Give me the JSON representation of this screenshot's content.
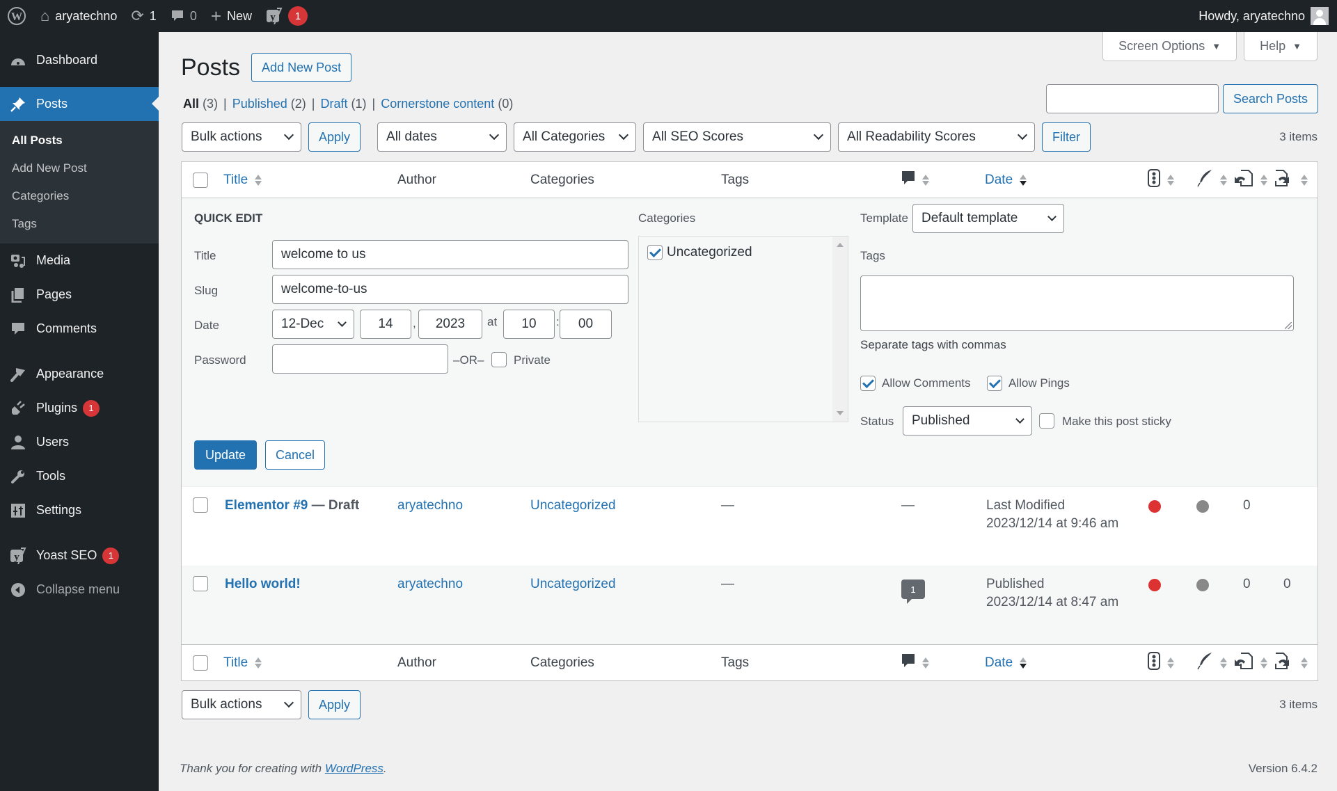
{
  "adminbar": {
    "wp_logo": "wordpress-logo",
    "site_name": "aryatechno",
    "updates_count": "1",
    "comments_count": "0",
    "new_label": "New",
    "yoast_badge": "1",
    "howdy": "Howdy, aryatechno"
  },
  "sidebar": {
    "dashboard": "Dashboard",
    "posts": "Posts",
    "posts_sub": [
      "All Posts",
      "Add New Post",
      "Categories",
      "Tags"
    ],
    "media": "Media",
    "pages": "Pages",
    "comments": "Comments",
    "appearance": "Appearance",
    "plugins": "Plugins",
    "plugins_badge": "1",
    "users": "Users",
    "tools": "Tools",
    "settings": "Settings",
    "yoast": "Yoast SEO",
    "yoast_badge": "1",
    "collapse": "Collapse menu"
  },
  "screen_meta": {
    "screen_options": "Screen Options",
    "help": "Help"
  },
  "page": {
    "title": "Posts",
    "add_new": "Add New Post"
  },
  "views": [
    {
      "label": "All",
      "count": "(3)"
    },
    {
      "label": "Published",
      "count": "(2)"
    },
    {
      "label": "Draft",
      "count": "(1)"
    },
    {
      "label": "Cornerstone content",
      "count": "(0)"
    }
  ],
  "search": {
    "value": "",
    "button": "Search Posts"
  },
  "tablenav_top": {
    "bulk": "Bulk actions",
    "apply": "Apply",
    "dates": "All dates",
    "categories": "All Categories",
    "seo": "All SEO Scores",
    "readability": "All Readability Scores",
    "filter": "Filter",
    "items": "3 items"
  },
  "columns": {
    "title": "Title",
    "author": "Author",
    "categories": "Categories",
    "tags": "Tags",
    "date": "Date"
  },
  "quick_edit": {
    "heading": "QUICK EDIT",
    "title_label": "Title",
    "title_value": "welcome to us",
    "slug_label": "Slug",
    "slug_value": "welcome-to-us",
    "date_label": "Date",
    "month": "12-Dec",
    "day": "14",
    "year": "2023",
    "at": "at",
    "hour": "10",
    "minute": "00",
    "password_label": "Password",
    "password_value": "",
    "or": "–OR–",
    "private_label": "Private",
    "private_checked": false,
    "categories_label": "Categories",
    "category_items": [
      {
        "label": "Uncategorized",
        "checked": true
      }
    ],
    "template_label": "Template",
    "template_value": "Default template",
    "tags_label": "Tags",
    "tags_value": "",
    "tags_hint": "Separate tags with commas",
    "allow_comments": "Allow Comments",
    "allow_pings": "Allow Pings",
    "status_label": "Status",
    "status_value": "Published",
    "sticky_label": "Make this post sticky",
    "update": "Update",
    "cancel": "Cancel"
  },
  "rows": [
    {
      "title": "Elementor #9",
      "state": " — Draft",
      "author": "aryatechno",
      "category": "Uncategorized",
      "tags": "—",
      "comments": "—",
      "date_status": "Last Modified",
      "date": "2023/12/14 at 9:46 am",
      "seo_color": "#dc3232",
      "readability_color": "#888888",
      "links_out": "0",
      "links_in": ""
    },
    {
      "title": "Hello world!",
      "state": "",
      "author": "aryatechno",
      "category": "Uncategorized",
      "tags": "—",
      "comments": "1",
      "date_status": "Published",
      "date": "2023/12/14 at 8:47 am",
      "seo_color": "#dc3232",
      "readability_color": "#888888",
      "links_out": "0",
      "links_in": "0"
    }
  ],
  "tablenav_bottom": {
    "bulk": "Bulk actions",
    "apply": "Apply",
    "items": "3 items"
  },
  "footer": {
    "text": "Thank you for creating with ",
    "link": "WordPress",
    "end": ".",
    "version": "Version 6.4.2"
  }
}
